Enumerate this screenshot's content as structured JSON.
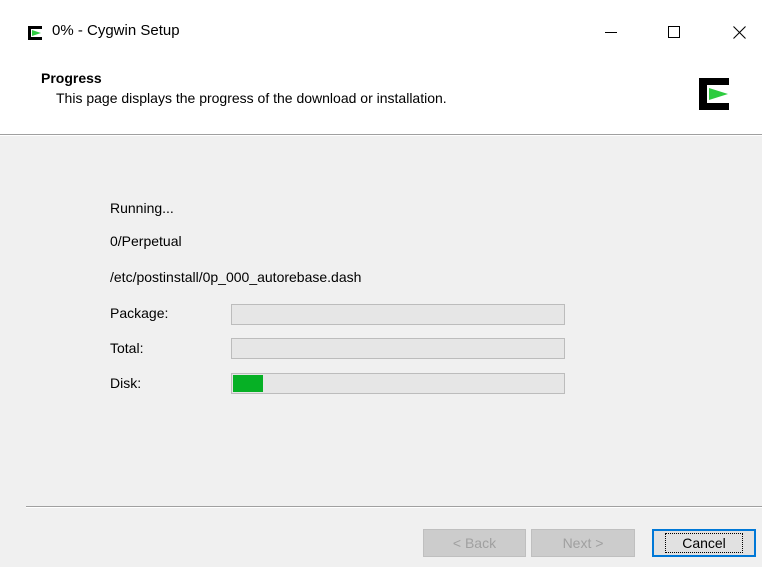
{
  "window": {
    "title": "0% - Cygwin Setup",
    "icon": "cygwin-logo-icon",
    "controls": {
      "minimize": "minimize-icon",
      "maximize": "maximize-icon",
      "close": "close-icon"
    }
  },
  "header": {
    "title": "Progress",
    "description": "This page displays the progress of the download or installation.",
    "logo": "cygwin-logo-icon"
  },
  "status": {
    "line1": "Running...",
    "line2": "0/Perpetual",
    "line3": "/etc/postinstall/0p_000_autorebase.dash"
  },
  "progress": {
    "package": {
      "label": "Package:",
      "value": 0
    },
    "total": {
      "label": "Total:",
      "value": 0
    },
    "disk": {
      "label": "Disk:",
      "value": 0.09
    }
  },
  "buttons": {
    "back": "< Back",
    "next": "Next >",
    "cancel": "Cancel"
  },
  "colors": {
    "progress_fill": "#06b025",
    "logo_green": "#2ecc40",
    "accent_focus": "#0078d7"
  }
}
